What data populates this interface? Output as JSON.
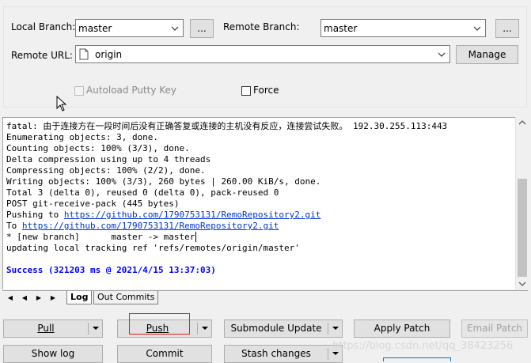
{
  "top": {
    "local_branch_label": "Local Branch:",
    "local_branch_value": "master",
    "browse_local_label": "...",
    "remote_branch_label": "Remote Branch:",
    "remote_branch_value": "master",
    "browse_remote_label": "...",
    "remote_url_label": "Remote URL:",
    "remote_url_value": "origin",
    "manage_label": "Manage",
    "autoload_label": "Autoload Putty Key",
    "force_label": "Force"
  },
  "log": {
    "lines": [
      "fatal: 由于连接方在一段时间后没有正确答复或连接的主机没有反应，连接尝试失败。 192.30.255.113:443",
      "Enumerating objects: 3, done.",
      "Counting objects: 100% (3/3), done.",
      "Delta compression using up to 4 threads",
      "Compressing objects: 100% (2/2), done.",
      "Writing objects: 100% (3/3), 260 bytes | 260.00 KiB/s, done.",
      "Total 3 (delta 0), reused 0 (delta 0), pack-reused 0",
      "POST git-receive-pack (445 bytes)"
    ],
    "pushing_prefix": "Pushing to ",
    "pushing_url": "https://github.com/1790753131/RemoRepository2.git",
    "to_prefix": "To ",
    "to_url": "https://github.com/1790753131/RemoRepository2.git",
    "branch_line": "* [new branch]      master -> master",
    "tracking_line": "updating local tracking ref 'refs/remotes/origin/master'",
    "success_line": "Success (321203 ms @ 2021/4/15 13:37:03)"
  },
  "tabs": {
    "log": "Log",
    "out_commits": "Out Commits"
  },
  "buttons": {
    "pull": "Pull",
    "push": "Push",
    "submodule_update": "Submodule Update",
    "apply_patch": "Apply Patch",
    "email_patch": "Email Patch",
    "show_log": "Show log",
    "commit": "Commit",
    "stash_changes": "Stash changes"
  },
  "watermark": "https://blog.csdn.net/qq_38423256",
  "colors": {
    "success": "#0000ff",
    "link": "#0033cc",
    "highlight_box": "#e02020"
  }
}
